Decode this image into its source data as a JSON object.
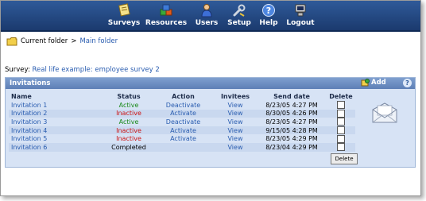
{
  "nav": {
    "items": [
      {
        "label": "Surveys",
        "icon": "surveys-icon"
      },
      {
        "label": "Resources",
        "icon": "resources-icon"
      },
      {
        "label": "Users",
        "icon": "users-icon"
      },
      {
        "label": "Setup",
        "icon": "setup-icon"
      },
      {
        "label": "Help",
        "icon": "help-icon"
      },
      {
        "label": "Logout",
        "icon": "logout-icon"
      }
    ]
  },
  "breadcrumb": {
    "current_label": "Current folder",
    "separator": ">",
    "folder_link": "Main folder"
  },
  "survey": {
    "label": "Survey:",
    "name": "Real life example: employee survey 2"
  },
  "panel": {
    "title": "Invitations",
    "add_label": "Add",
    "help_label": "?",
    "delete_label": "Delete"
  },
  "table": {
    "headers": {
      "name": "Name",
      "status": "Status",
      "action": "Action",
      "invitees": "Invitees",
      "send_date": "Send date",
      "delete": "Delete"
    },
    "rows": [
      {
        "name": "Invitation 1",
        "status": "Active",
        "status_type": "active",
        "action": "Deactivate",
        "invitees": "View",
        "send_date": "8/23/05 4:27 PM"
      },
      {
        "name": "Invitation 2",
        "status": "Inactive",
        "status_type": "inactive",
        "action": "Activate",
        "invitees": "View",
        "send_date": "8/30/05 4:26 PM"
      },
      {
        "name": "Invitation 3",
        "status": "Active",
        "status_type": "active",
        "action": "Deactivate",
        "invitees": "View",
        "send_date": "8/23/05 4:27 PM"
      },
      {
        "name": "Invitation 4",
        "status": "Inactive",
        "status_type": "inactive",
        "action": "Activate",
        "invitees": "View",
        "send_date": "9/15/05 4:28 PM"
      },
      {
        "name": "Invitation 5",
        "status": "Inactive",
        "status_type": "inactive",
        "action": "Activate",
        "invitees": "View",
        "send_date": "8/23/05 4:29 PM"
      },
      {
        "name": "Invitation 6",
        "status": "Completed",
        "status_type": "completed",
        "action": "",
        "invitees": "View",
        "send_date": "8/23/04 4:29 PM"
      }
    ]
  },
  "colors": {
    "nav_bg": "#1b3a6e",
    "link": "#2a5db0",
    "active": "#1a8a1a",
    "inactive": "#cc1111",
    "panel_bg": "#d7e3f5",
    "panel_header": "#5d7fb6"
  }
}
